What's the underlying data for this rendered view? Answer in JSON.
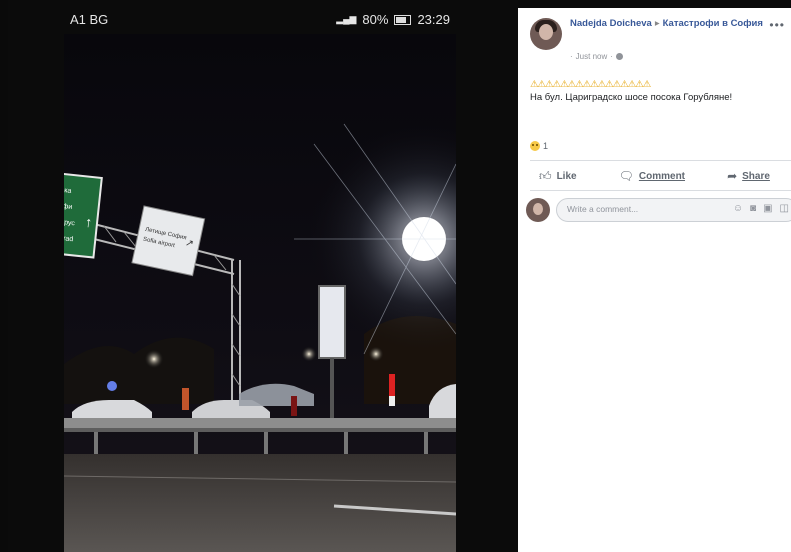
{
  "phone": {
    "carrier": "A1 BG",
    "signal": "4G",
    "battery": "80%",
    "time": "23:29"
  },
  "post": {
    "author": "Nadejda Doicheva",
    "group": "Катастрофи в София",
    "timestamp": "Just now",
    "warning_emojis": "⚠⚠⚠⚠⚠⚠⚠⚠⚠⚠⚠⚠⚠⚠⚠⚠",
    "text": "На бул. Цариградско шосе посока Горубляне!",
    "reaction_count": "1",
    "actions": {
      "like": "Like",
      "comment": "Comment",
      "share": "Share"
    },
    "comment_placeholder": "Write a comment..."
  },
  "icons": {
    "more": "more-icon",
    "globe": "globe-icon",
    "sad_reaction": "sad-reaction-icon",
    "like": "thumbs-up-icon",
    "comment": "speech-bubble-icon",
    "share": "share-arrow-icon",
    "emoji": "emoji-icon",
    "camera": "camera-icon",
    "gif": "gif-icon",
    "sticker": "sticker-icon"
  },
  "colors": {
    "link": "#385898",
    "secondary_text": "#606770",
    "warning": "#e6a817"
  }
}
